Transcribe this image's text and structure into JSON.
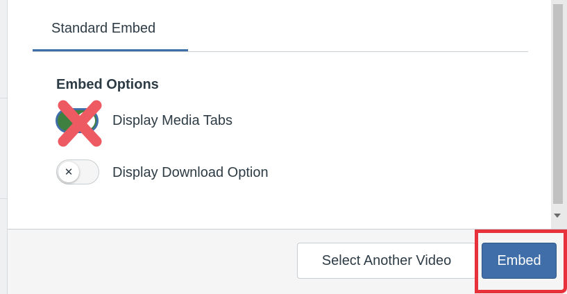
{
  "tabs": [
    {
      "label": "Standard Embed",
      "active": true
    }
  ],
  "embed_options": {
    "heading": "Embed Options",
    "options": [
      {
        "label": "Display Media Tabs",
        "enabled": true
      },
      {
        "label": "Display Download Option",
        "enabled": false
      }
    ]
  },
  "footer": {
    "select_another_label": "Select Another Video",
    "embed_label": "Embed"
  },
  "icons": {
    "toggle_off_glyph": "✕",
    "annotation": "red-x-icon"
  },
  "colors": {
    "accent": "#3f6ea8",
    "toggle_on": "#3f7f3f",
    "annotation_red": "#e8323b",
    "text": "#2d3b45"
  }
}
